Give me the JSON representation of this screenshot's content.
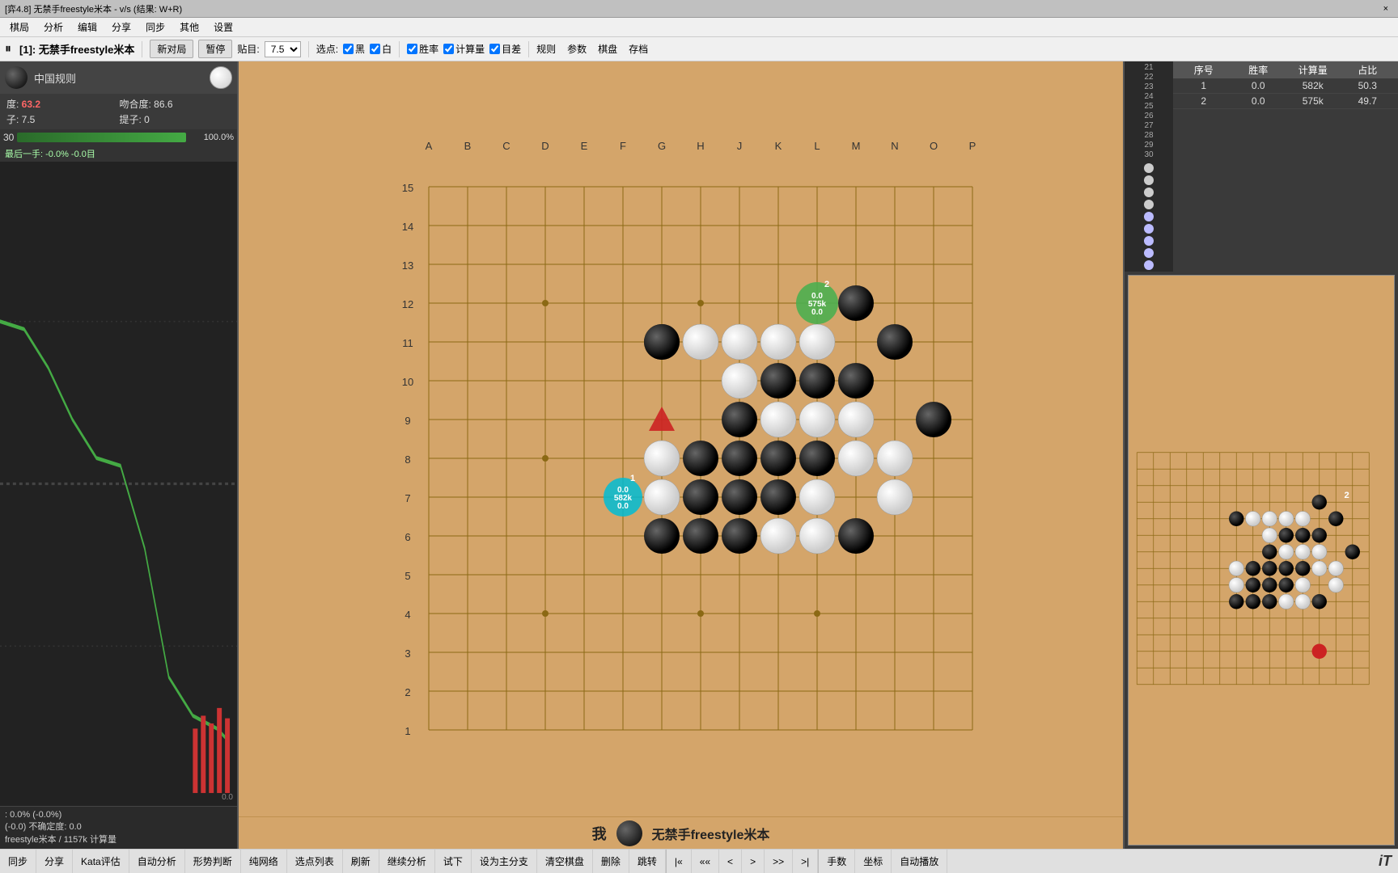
{
  "titlebar": {
    "title": "[弈4.8] 无禁手freestyle米本 - v/s (结果: W+R)",
    "close": "×"
  },
  "menubar": {
    "items": [
      "棋局",
      "分析",
      "编辑",
      "分享",
      "同步",
      "其他",
      "设置"
    ]
  },
  "toolbar": {
    "pause_icon": "⏸",
    "label": "[1]: 无禁手freestyle米本",
    "new_game": "新对局",
    "pause": "暂停",
    "komi_label": "贴目:",
    "komi_value": "7.5",
    "select_label": "选点:",
    "black_label": "黑",
    "white_label": "白",
    "winrate_label": "胜率",
    "calc_label": "计算量",
    "score_label": "目差",
    "rules_label": "规则",
    "params_label": "参数",
    "board_label": "棋盘",
    "save_label": "存档"
  },
  "left_panel": {
    "rule": "中国规则",
    "score": "63.2",
    "match_rate": "86.6",
    "komi_val": "7.5",
    "captures": "0",
    "captures2": "0",
    "progress_moves": "30",
    "progress_pct": "100.0%",
    "last_move": "最后一手: -0.0% -0.0目",
    "bottom_stats": ": 0.0% (-0.0%)\n(-0.0) 不确定度: 0.0\neestyle米本 / 1157k 计算量"
  },
  "analysis": {
    "move1": {
      "seq": "1",
      "winrate": "0.0",
      "calc": "582k",
      "ratio": "50.3"
    },
    "move2": {
      "seq": "2",
      "winrate": "0.0",
      "calc": "575k",
      "ratio": "49.7"
    }
  },
  "board": {
    "cols": [
      "A",
      "B",
      "C",
      "D",
      "E",
      "F",
      "G",
      "H",
      "J",
      "K",
      "L",
      "M",
      "N",
      "O",
      "P"
    ],
    "rows": [
      "15",
      "14",
      "13",
      "12",
      "11",
      "10",
      "9",
      "8",
      "7",
      "6",
      "5",
      "4",
      "3",
      "2",
      "1"
    ],
    "player_me": "我",
    "player_ai": "无禁手freestyle米本"
  },
  "statusbar": {
    "buttons": [
      "同步",
      "分享",
      "Kata评估",
      "自动分析",
      "形势判断",
      "纯网络",
      "选点列表",
      "刷新",
      "继续分析",
      "试下",
      "设为主分支",
      "清空棋盘",
      "删除",
      "跳转",
      "«",
      "«",
      "<",
      ">",
      "»",
      ">|",
      "手数",
      "坐标",
      "自动播放"
    ]
  },
  "hint1": {
    "label": "0.0\n582k\n0.0",
    "num": "1"
  },
  "hint2": {
    "label": "0.0\n575k\n0.0",
    "num": "2"
  },
  "colors": {
    "board_bg": "#d4a56a",
    "line_color": "#8b6914",
    "black_stone": "#111",
    "white_stone": "#f0f0f0"
  }
}
